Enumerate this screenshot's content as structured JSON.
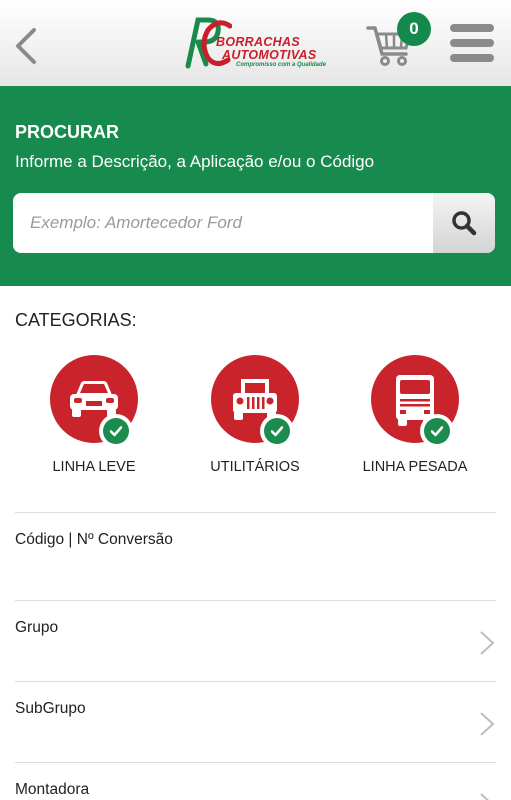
{
  "header": {
    "logo": {
      "mark": "RC",
      "line1": "BORRACHAS",
      "line2": "AUTOMOTIVAS",
      "tagline": "Compromisso com a Qualidade"
    },
    "cart_count": "0",
    "icons": {
      "back": "chevron-left-icon",
      "cart": "cart-icon",
      "menu": "hamburger-menu-icon"
    }
  },
  "search": {
    "title": "PROCURAR",
    "subtitle": "Informe a Descrição, a Aplicação e/ou o Código",
    "placeholder": "Exemplo: Amortecedor Ford",
    "button_icon": "search-icon"
  },
  "categories": {
    "title": "CATEGORIAS:",
    "items": [
      {
        "label": "LINHA LEVE",
        "icon": "car-icon",
        "selected": true
      },
      {
        "label": "UTILITÁRIOS",
        "icon": "jeep-icon",
        "selected": true
      },
      {
        "label": "LINHA PESADA",
        "icon": "truck-icon",
        "selected": true
      }
    ]
  },
  "filters": [
    {
      "label": "Código | Nº Conversão",
      "has_chevron": false
    },
    {
      "label": "Grupo",
      "has_chevron": true
    },
    {
      "label": "SubGrupo",
      "has_chevron": true
    },
    {
      "label": "Montadora",
      "has_chevron": true
    }
  ],
  "colors": {
    "brand_green": "#168b4d",
    "brand_red": "#c9232b",
    "badge_green": "#138a4b"
  }
}
